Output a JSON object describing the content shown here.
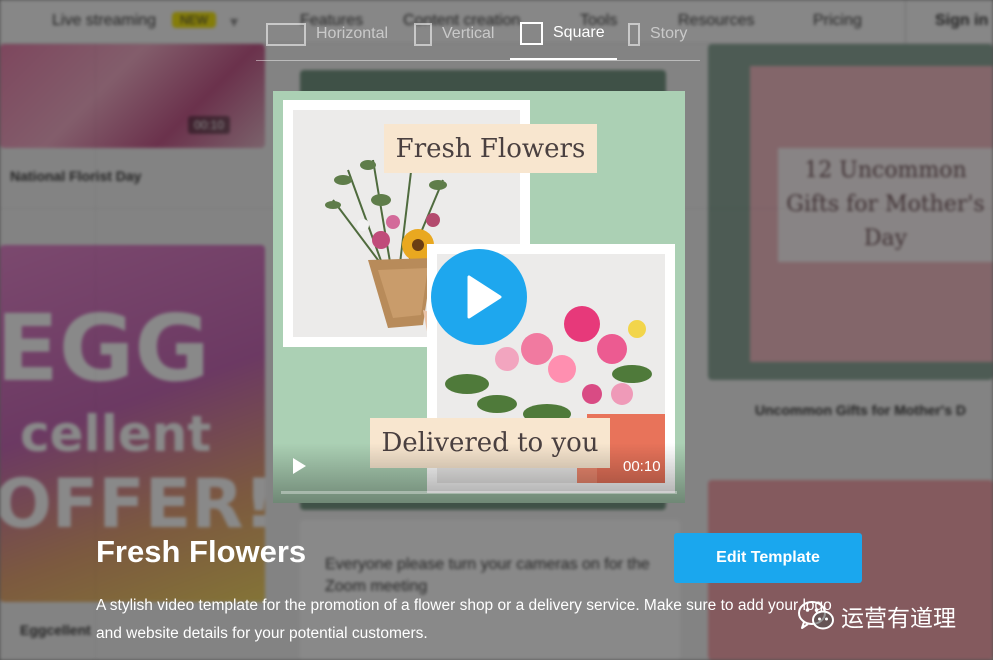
{
  "background": {
    "nav": {
      "live_streaming": "Live streaming",
      "new_badge": "NEW",
      "features": "Features",
      "content_creation": "Content creation",
      "tools": "Tools",
      "resources": "Resources",
      "pricing": "Pricing",
      "sign_in": "Sign in"
    },
    "cards": {
      "national_floral_day": "National Florist Day",
      "duration_badge": "00:10",
      "egg_line1": "EGG",
      "egg_line2": "cellent",
      "egg_line3": "OFFER!",
      "eggcellent_caption": "Eggcellent",
      "mothers_day_line1": "12 Uncommon",
      "mothers_day_line2": "Gifts for Mother's",
      "mothers_day_line3": "Day",
      "mothers_day_caption": "Uncommon Gifts for Mother's D",
      "zoom_text": "Everyone please turn your cameras on for the Zoom meeting"
    }
  },
  "format_selector": {
    "options": [
      {
        "label": "Horizontal",
        "active": false
      },
      {
        "label": "Vertical",
        "active": false
      },
      {
        "label": "Square",
        "active": true
      },
      {
        "label": "Story",
        "active": false
      }
    ]
  },
  "video": {
    "caption_top": "Fresh Flowers",
    "caption_bottom": "Delivered to you",
    "timecode": "00:10",
    "progress": 0
  },
  "template": {
    "title": "Fresh Flowers",
    "edit_label": "Edit Template",
    "description": "A stylish video template for the promotion of a flower shop or a delivery service. Make sure to add your logo and website details for your potential customers."
  },
  "watermark": {
    "text": "运营有道理"
  },
  "colors": {
    "accent": "#1aa7ee",
    "video_bg": "#abd0b4",
    "tag_bg": "#f8e6cf"
  }
}
